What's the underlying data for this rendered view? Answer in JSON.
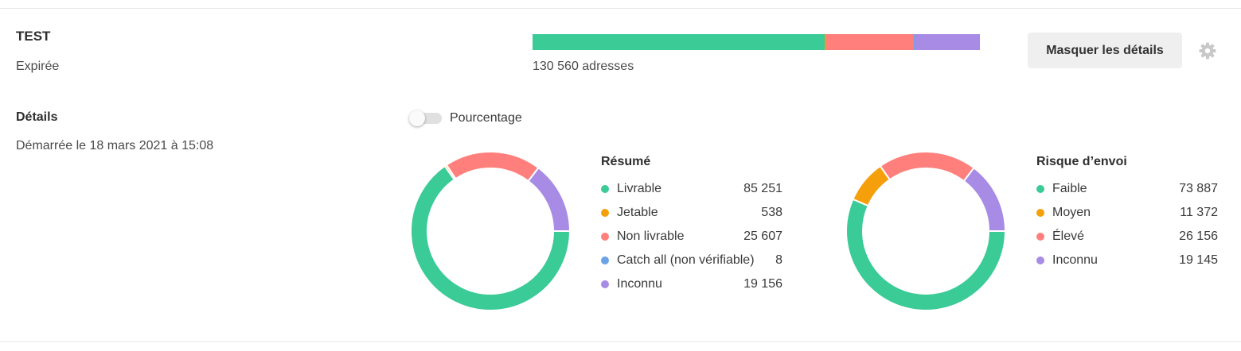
{
  "header": {
    "title": "TEST",
    "status": "Expirée",
    "total_label": "130 560 adresses",
    "hide_details_label": "Masquer les détails",
    "settings_icon": "gear-icon"
  },
  "details": {
    "heading": "Détails",
    "started": "Démarrée le 18 mars 2021 à 15:08"
  },
  "toggle": {
    "label": "Pourcentage",
    "on": false
  },
  "colors": {
    "green": "#3acb97",
    "orange": "#f59f0b",
    "red": "#fe7f7b",
    "blue": "#6ba4e6",
    "purple": "#a78be5"
  },
  "summary": {
    "title": "Résumé",
    "items": [
      {
        "label": "Livrable",
        "value": "85 251",
        "count": 85251,
        "color": "#3acb97"
      },
      {
        "label": "Jetable",
        "value": "538",
        "count": 538,
        "color": "#f59f0b"
      },
      {
        "label": "Non livrable",
        "value": "25 607",
        "count": 25607,
        "color": "#fe7f7b"
      },
      {
        "label": "Catch all (non vérifiable)",
        "value": "8",
        "count": 8,
        "color": "#6ba4e6"
      },
      {
        "label": "Inconnu",
        "value": "19 156",
        "count": 19156,
        "color": "#a78be5"
      }
    ]
  },
  "risk": {
    "title": "Risque d’envoi",
    "items": [
      {
        "label": "Faible",
        "value": "73 887",
        "count": 73887,
        "color": "#3acb97"
      },
      {
        "label": "Moyen",
        "value": "11 372",
        "count": 11372,
        "color": "#f59f0b"
      },
      {
        "label": "Élevé",
        "value": "26 156",
        "count": 26156,
        "color": "#fe7f7b"
      },
      {
        "label": "Inconnu",
        "value": "19 145",
        "count": 19145,
        "color": "#a78be5"
      }
    ]
  }
}
